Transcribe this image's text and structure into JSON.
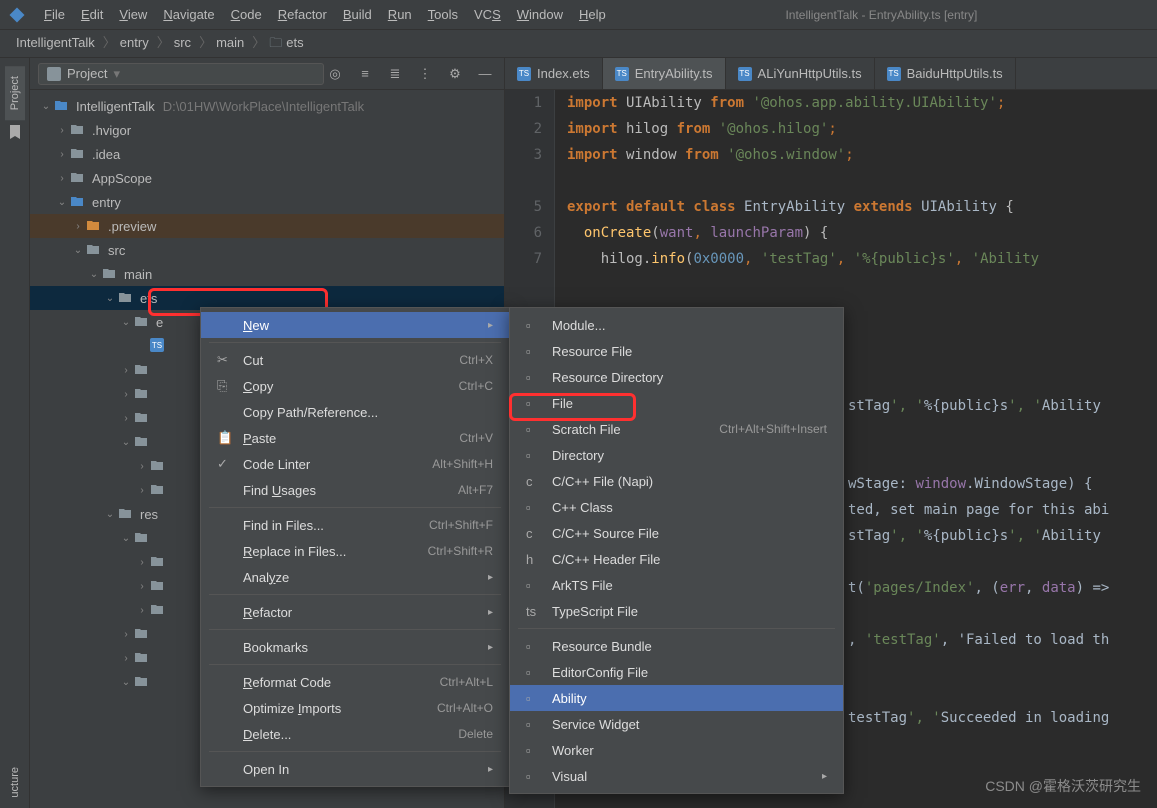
{
  "window": {
    "title": "IntelligentTalk - EntryAbility.ts [entry]"
  },
  "menubar": [
    {
      "label": "File",
      "u": 0
    },
    {
      "label": "Edit",
      "u": 0
    },
    {
      "label": "View",
      "u": 0
    },
    {
      "label": "Navigate",
      "u": 0
    },
    {
      "label": "Code",
      "u": 0
    },
    {
      "label": "Refactor",
      "u": 0
    },
    {
      "label": "Build",
      "u": 0
    },
    {
      "label": "Run",
      "u": 0
    },
    {
      "label": "Tools",
      "u": 0
    },
    {
      "label": "VCS",
      "u": 2
    },
    {
      "label": "Window",
      "u": 0
    },
    {
      "label": "Help",
      "u": 0
    }
  ],
  "breadcrumb": [
    "IntelligentTalk",
    "entry",
    "src",
    "main",
    "ets"
  ],
  "panel": {
    "title": "Project"
  },
  "tree": [
    {
      "d": 0,
      "arrow": "v",
      "icon": "module",
      "label": "IntelligentTalk",
      "path": "D:\\01HW\\WorkPlace\\IntelligentTalk"
    },
    {
      "d": 1,
      "arrow": ">",
      "icon": "folder",
      "label": ".hvigor"
    },
    {
      "d": 1,
      "arrow": ">",
      "icon": "folder",
      "label": ".idea"
    },
    {
      "d": 1,
      "arrow": ">",
      "icon": "folder",
      "label": "AppScope"
    },
    {
      "d": 1,
      "arrow": "v",
      "icon": "module",
      "label": "entry"
    },
    {
      "d": 2,
      "arrow": ">",
      "icon": "folder-o",
      "label": ".preview",
      "hl": true
    },
    {
      "d": 2,
      "arrow": "v",
      "icon": "folder",
      "label": "src"
    },
    {
      "d": 3,
      "arrow": "v",
      "icon": "folder",
      "label": "main"
    },
    {
      "d": 4,
      "arrow": "v",
      "icon": "folder",
      "label": "ets",
      "sel": true
    },
    {
      "d": 5,
      "arrow": "v",
      "icon": "folder",
      "label": "e"
    },
    {
      "d": 6,
      "arrow": "",
      "icon": "ts",
      "label": ""
    },
    {
      "d": 5,
      "arrow": ">",
      "icon": "folder",
      "label": ""
    },
    {
      "d": 5,
      "arrow": ">",
      "icon": "folder",
      "label": ""
    },
    {
      "d": 5,
      "arrow": ">",
      "icon": "folder",
      "label": ""
    },
    {
      "d": 5,
      "arrow": "v",
      "icon": "folder",
      "label": ""
    },
    {
      "d": 6,
      "arrow": ">",
      "icon": "folder",
      "label": ""
    },
    {
      "d": 6,
      "arrow": ">",
      "icon": "folder",
      "label": ""
    },
    {
      "d": 4,
      "arrow": "v",
      "icon": "folder",
      "label": "res"
    },
    {
      "d": 5,
      "arrow": "v",
      "icon": "folder",
      "label": ""
    },
    {
      "d": 6,
      "arrow": ">",
      "icon": "folder",
      "label": ""
    },
    {
      "d": 6,
      "arrow": ">",
      "icon": "folder",
      "label": ""
    },
    {
      "d": 6,
      "arrow": ">",
      "icon": "folder",
      "label": ""
    },
    {
      "d": 5,
      "arrow": ">",
      "icon": "folder",
      "label": ""
    },
    {
      "d": 5,
      "arrow": ">",
      "icon": "folder",
      "label": ""
    },
    {
      "d": 5,
      "arrow": "v",
      "icon": "folder",
      "label": ""
    }
  ],
  "tabs": [
    {
      "label": "Index.ets"
    },
    {
      "label": "EntryAbility.ts",
      "active": true
    },
    {
      "label": "ALiYunHttpUtils.ts"
    },
    {
      "label": "BaiduHttpUtils.ts"
    }
  ],
  "code": {
    "lines": [
      1,
      2,
      3,
      "",
      5,
      6,
      7
    ],
    "html": "<span class='kw'>import</span> UIAbility <span class='kw'>from</span> <span class='str'>'@ohos.app.ability.UIAbility'</span><span class='punct'>;</span>\n<span class='kw'>import</span> hilog <span class='kw'>from</span> <span class='str'>'@ohos.hilog'</span><span class='punct'>;</span>\n<span class='kw'>import</span> window <span class='kw'>from</span> <span class='str'>'@ohos.window'</span><span class='punct'>;</span>\n\n<span class='kw'>export default class</span> <span class='cls'>EntryAbility</span> <span class='kw'>extends</span> <span class='cls'>UIAbility</span> {\n  <span class='fn'>onCreate</span>(<span class='id'>want</span><span class='punct'>,</span> <span class='id'>launchParam</span>) {\n    hilog.<span class='fn'>info</span>(<span class='num'>0x0000</span><span class='punct'>,</span> <span class='str'>'testTag'</span><span class='punct'>,</span> <span class='str'>'%{public}s'</span><span class='punct'>,</span> <span class='str'>'Ability"
  },
  "code_overlay": [
    "stTag', '%{public}s', 'Ability",
    "",
    "",
    "wStage: window.WindowStage) {",
    "ted, set main page for this abi",
    "stTag', '%{public}s', 'Ability",
    "",
    "t('pages/Index', (err, data) =>",
    "",
    ", 'testTag', 'Failed to load th",
    "",
    "",
    "testTag', 'Succeeded in loading"
  ],
  "context1": [
    {
      "label": "New",
      "u": 0,
      "sel": true,
      "arrow": true
    },
    {
      "sep": true
    },
    {
      "icon": "✂",
      "label": "Cut",
      "u": -1,
      "sc": "Ctrl+X"
    },
    {
      "icon": "⎘",
      "label": "Copy",
      "u": 0,
      "sc": "Ctrl+C"
    },
    {
      "label": "Copy Path/Reference..."
    },
    {
      "icon": "📋",
      "label": "Paste",
      "u": 0,
      "sc": "Ctrl+V"
    },
    {
      "icon": "✓",
      "label": "Code Linter",
      "sc": "Alt+Shift+H"
    },
    {
      "label": "Find Usages",
      "u": 5,
      "sc": "Alt+F7"
    },
    {
      "sep": true
    },
    {
      "label": "Find in Files...",
      "sc": "Ctrl+Shift+F"
    },
    {
      "label": "Replace in Files...",
      "u": 0,
      "sc": "Ctrl+Shift+R"
    },
    {
      "label": "Analyze",
      "u": 4,
      "arrow": true
    },
    {
      "sep": true
    },
    {
      "label": "Refactor",
      "u": 0,
      "arrow": true
    },
    {
      "sep": true
    },
    {
      "label": "Bookmarks",
      "arrow": true
    },
    {
      "sep": true
    },
    {
      "label": "Reformat Code",
      "u": 0,
      "sc": "Ctrl+Alt+L"
    },
    {
      "label": "Optimize Imports",
      "u": 9,
      "sc": "Ctrl+Alt+O"
    },
    {
      "label": "Delete...",
      "u": 0,
      "sc": "Delete"
    },
    {
      "sep": true
    },
    {
      "label": "Open In",
      "arrow": true
    }
  ],
  "context2": [
    {
      "icon": "module",
      "label": "Module..."
    },
    {
      "icon": "file",
      "label": "Resource File"
    },
    {
      "icon": "folder",
      "label": "Resource Directory"
    },
    {
      "icon": "file",
      "label": "File"
    },
    {
      "icon": "scratch",
      "label": "Scratch File",
      "sc": "Ctrl+Alt+Shift+Insert"
    },
    {
      "icon": "folder",
      "label": "Directory"
    },
    {
      "icon": "c",
      "label": "C/C++ File (Napi)"
    },
    {
      "icon": "cpp",
      "label": "C++ Class"
    },
    {
      "icon": "c",
      "label": "C/C++ Source File"
    },
    {
      "icon": "h",
      "label": "C/C++ Header File"
    },
    {
      "icon": "ets",
      "label": "ArkTS File"
    },
    {
      "icon": "ts",
      "label": "TypeScript File"
    },
    {
      "sep": true
    },
    {
      "icon": "bundle",
      "label": "Resource Bundle"
    },
    {
      "icon": "config",
      "label": "EditorConfig File"
    },
    {
      "icon": "ability",
      "label": "Ability",
      "sel": true
    },
    {
      "icon": "widget",
      "label": "Service Widget"
    },
    {
      "icon": "worker",
      "label": "Worker"
    },
    {
      "icon": "visual",
      "label": "Visual",
      "arrow": true
    }
  ],
  "watermark": "CSDN @霍格沃茨研究生",
  "sidebar": {
    "project": "Project",
    "structure": "ucture"
  }
}
